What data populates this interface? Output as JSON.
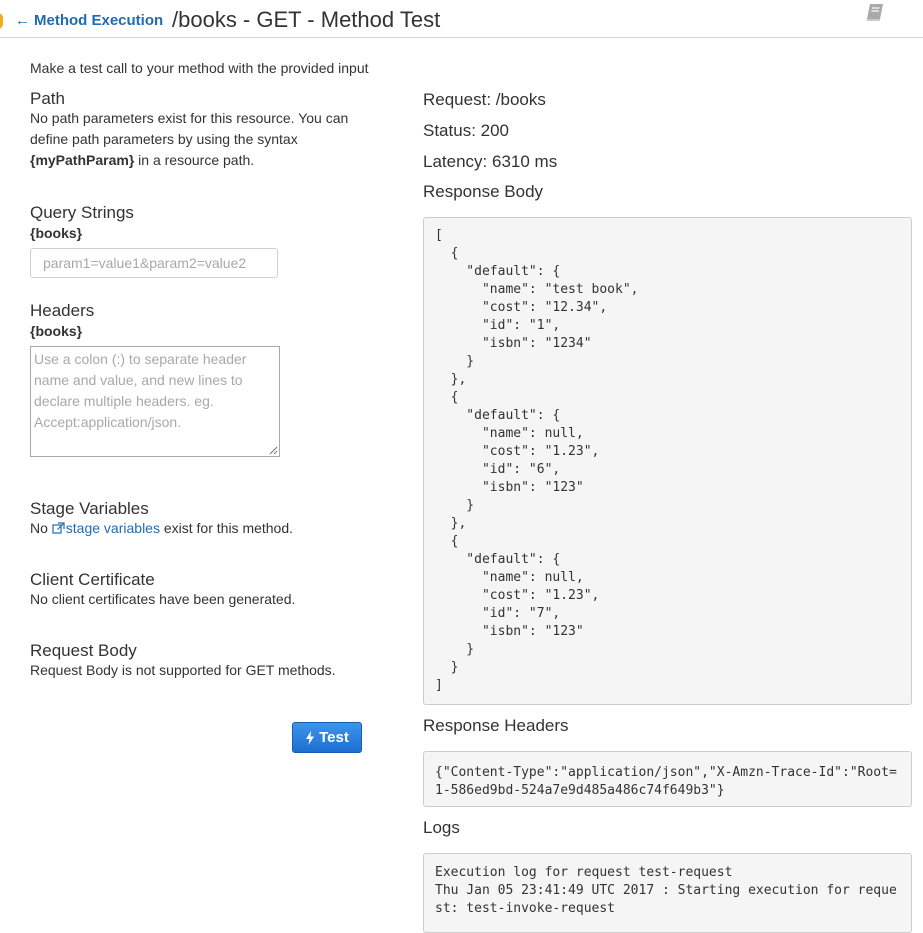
{
  "header": {
    "back_label": "Method Execution",
    "title": "/books - GET - Method Test"
  },
  "intro": "Make a test call to your method with the provided input",
  "path": {
    "title": "Path",
    "text_1": "No path parameters exist for this resource. You can define path parameters by using the syntax",
    "param_syntax": "{myPathParam}",
    "text_2": " in a resource path."
  },
  "query_strings": {
    "title": "Query Strings",
    "resource": "{books}",
    "placeholder": "param1=value1&param2=value2"
  },
  "headers": {
    "title": "Headers",
    "resource": "{books}",
    "placeholder": "Use a colon (:) to separate header name and value, and new lines to declare multiple headers. eg. Accept:application/json."
  },
  "stage_variables": {
    "title": "Stage Variables",
    "text_before": "No ",
    "link": "stage variables",
    "text_after": " exist for this method."
  },
  "client_certificate": {
    "title": "Client Certificate",
    "text": "No client certificates have been generated."
  },
  "request_body": {
    "title": "Request Body",
    "text": "Request Body is not supported for GET methods."
  },
  "test_button": {
    "label": "Test"
  },
  "result": {
    "request": "Request: /books",
    "status": "Status: 200",
    "latency": "Latency: 6310 ms",
    "response_body_title": "Response Body",
    "response_body": "[\n  {\n    \"default\": {\n      \"name\": \"test book\",\n      \"cost\": \"12.34\",\n      \"id\": \"1\",\n      \"isbn\": \"1234\"\n    }\n  },\n  {\n    \"default\": {\n      \"name\": null,\n      \"cost\": \"1.23\",\n      \"id\": \"6\",\n      \"isbn\": \"123\"\n    }\n  },\n  {\n    \"default\": {\n      \"name\": null,\n      \"cost\": \"1.23\",\n      \"id\": \"7\",\n      \"isbn\": \"123\"\n    }\n  }\n]",
    "response_headers_title": "Response Headers",
    "response_headers": "{\"Content-Type\":\"application/json\",\"X-Amzn-Trace-Id\":\"Root=\n1-586ed9bd-524a7e9d485a486c74f649b3\"}",
    "logs_title": "Logs",
    "logs": "Execution log for request test-request\nThu Jan 05 23:41:49 UTC 2017 : Starting execution for reque\nst: test-invoke-request"
  },
  "colors": {
    "link": "#1f6bb6",
    "button": "#2a80dd",
    "code_background": "#f5f5f5"
  },
  "icons": {
    "back": "arrow-left-icon",
    "book": "book-icon",
    "external_link": "external-link-icon",
    "test": "bolt-icon"
  }
}
